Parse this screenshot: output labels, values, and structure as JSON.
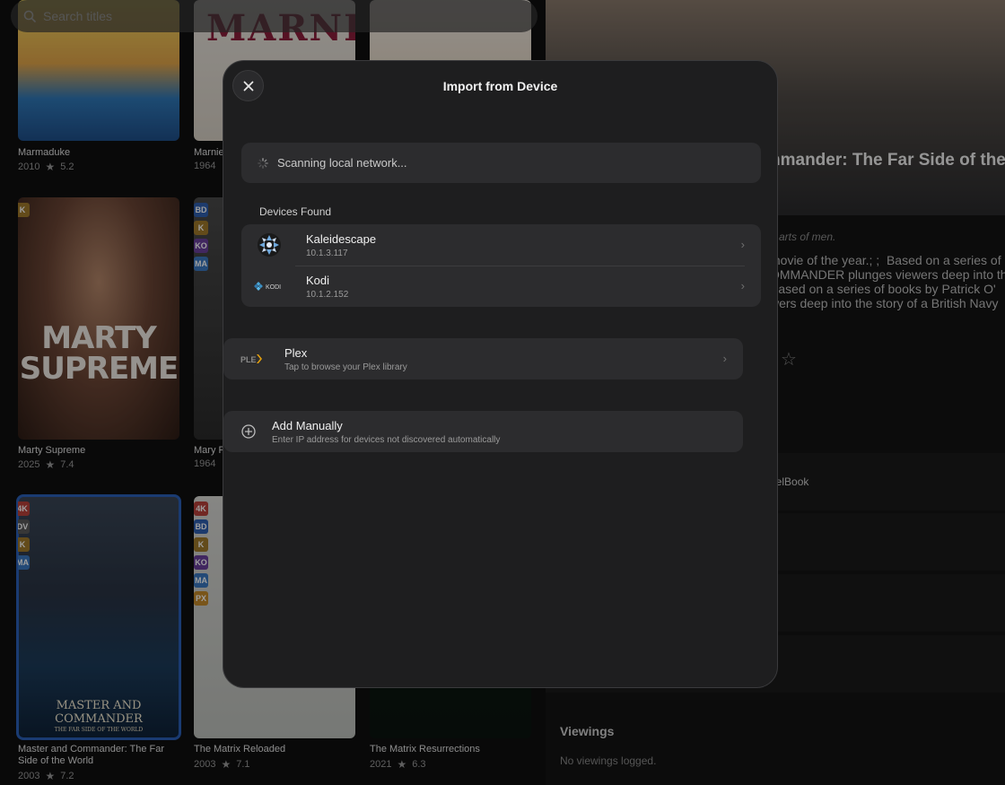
{
  "search": {
    "placeholder": "Search titles"
  },
  "grid": {
    "items": [
      {
        "title": "Marmaduke",
        "year": "2010",
        "rating": "5.2"
      },
      {
        "title": "Marnie",
        "year": "1964",
        "poster_text": "MARNIE"
      },
      {
        "title": "Marty Supreme",
        "year": "2025",
        "rating": "7.4",
        "poster_text": "MARTY SUPREME",
        "badges": [
          "K"
        ]
      },
      {
        "title": "Mary P",
        "year": "1964",
        "badges": [
          "BD",
          "K",
          "KO",
          "MA"
        ]
      },
      {
        "title": "Master and Commander: The Far Side of the World",
        "year": "2003",
        "rating": "7.2",
        "poster_text": "MASTER AND COMMANDER",
        "poster_sub": "THE FAR SIDE OF THE WORLD",
        "badges": [
          "4K",
          "DV",
          "K",
          "MA"
        ]
      },
      {
        "title": "The Matrix Reloaded",
        "year": "2003",
        "rating": "7.1",
        "badges": [
          "4K",
          "BD",
          "K",
          "KO",
          "MA",
          "PX"
        ]
      },
      {
        "title": "The Matrix Resurrections",
        "year": "2021",
        "rating": "6.3"
      }
    ],
    "badge_colors": {
      "4K": "#b8413a",
      "BD": "#2f5fb0",
      "DV": "#5a5a5a",
      "K": "#a07a2a",
      "KO": "#6a3f9c",
      "MA": "#3a78c0",
      "PX": "#c48a2a"
    }
  },
  "detail": {
    "hero_title": "nmander: The Far Side of the Wo",
    "tagline": "arts of men.",
    "overview_lines": [
      "movie of the year.; ;  Based on a series of",
      "OMMANDER plunges viewers deep into the",
      "Based on a series of books by Patrick O'",
      "wers deep into the story of a British Navy"
    ],
    "edition": "eelBook",
    "viewings_heading": "Viewings",
    "viewings_empty": "No viewings logged."
  },
  "modal": {
    "title": "Import from Device",
    "scanning_text": "Scanning local network...",
    "devices_heading": "Devices Found",
    "devices": [
      {
        "name": "Kaleidescape",
        "ip": "10.1.3.117",
        "icon": "kaleidescape-icon"
      },
      {
        "name": "Kodi",
        "ip": "10.1.2.152",
        "icon": "kodi-icon"
      }
    ],
    "plex": {
      "name": "Plex",
      "subtitle": "Tap to browse your Plex library"
    },
    "manual": {
      "name": "Add Manually",
      "subtitle": "Enter IP address for devices not discovered automatically"
    }
  },
  "colors": {
    "accent_selected": "#2a5fb8",
    "modal_bg": "#1e1e1f",
    "card_bg": "#2c2c2e"
  }
}
